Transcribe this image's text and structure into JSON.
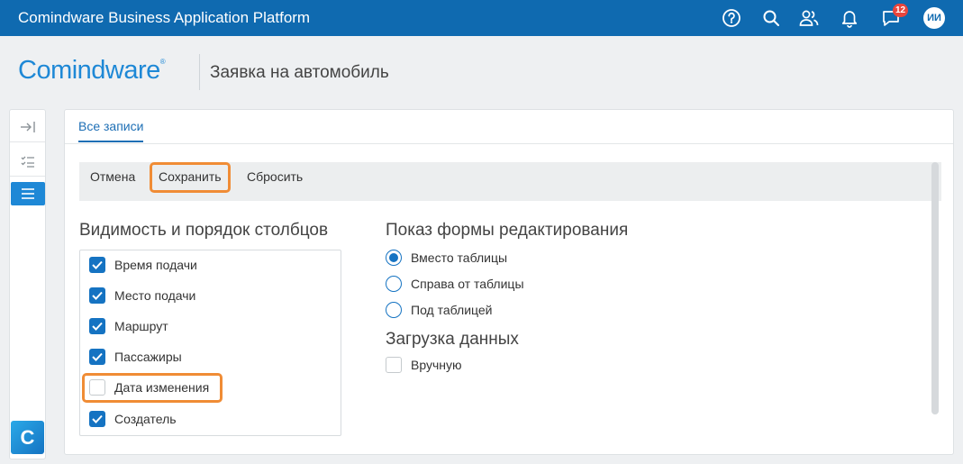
{
  "app": {
    "title": "Comindware Business Application Platform",
    "notification_count": "12",
    "avatar_initials": "ИИ"
  },
  "header": {
    "logo_text": "Comindware",
    "logo_mark": "®",
    "page_title": "Заявка на автомобиль"
  },
  "tabs": [
    {
      "label": "Все записи",
      "active": true
    }
  ],
  "toolbar": {
    "cancel_label": "Отмена",
    "save_label": "Сохранить",
    "reset_label": "Сбросить"
  },
  "columns_section": {
    "title": "Видимость и порядок столбцов",
    "items": [
      {
        "label": "Время подачи",
        "checked": true
      },
      {
        "label": "Место подачи",
        "checked": true
      },
      {
        "label": "Маршрут",
        "checked": true
      },
      {
        "label": "Пассажиры",
        "checked": true
      },
      {
        "label": "Дата изменения",
        "checked": false
      },
      {
        "label": "Создатель",
        "checked": true
      }
    ]
  },
  "edit_form_section": {
    "title": "Показ формы редактирования",
    "options": [
      {
        "label": "Вместо таблицы",
        "selected": true
      },
      {
        "label": "Справа от таблицы",
        "selected": false
      },
      {
        "label": "Под таблицей",
        "selected": false
      }
    ]
  },
  "data_load_section": {
    "title": "Загрузка данных",
    "manual_label": "Вручную",
    "manual_checked": false
  },
  "colors": {
    "brand": "#0f6ab0",
    "accent": "#1573c2",
    "highlight": "#f08c35",
    "badge": "#e8453c"
  }
}
